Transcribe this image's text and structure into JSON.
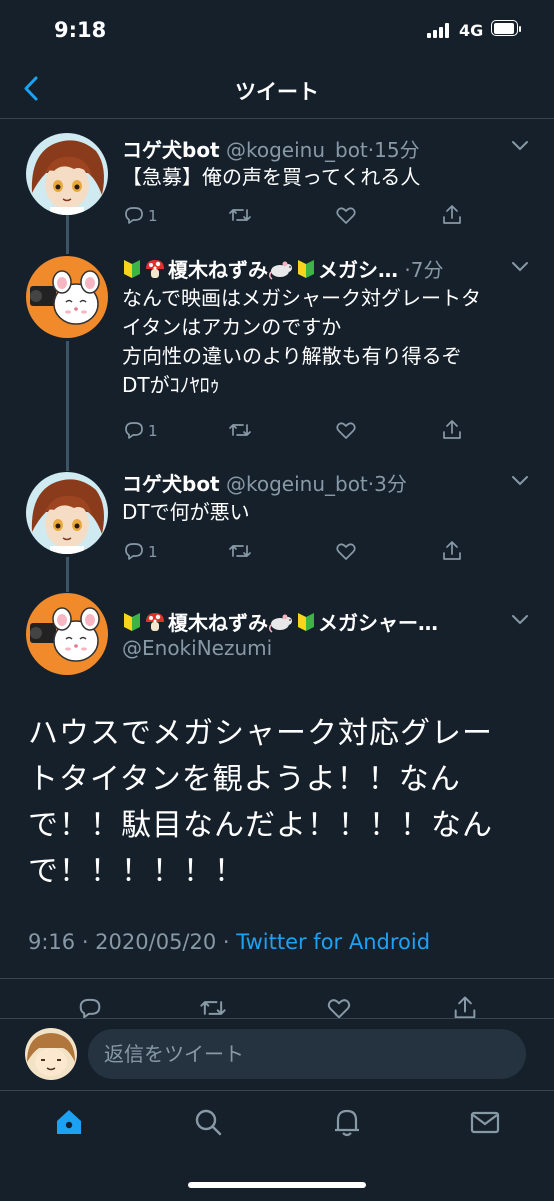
{
  "status_bar": {
    "time": "9:18",
    "network": "4G"
  },
  "header": {
    "title": "ツイート"
  },
  "colors": {
    "background": "#15202b",
    "accent": "#1da1f2",
    "muted": "#8899a6",
    "divider": "#38444d"
  },
  "thread": [
    {
      "name": "コゲ犬bot",
      "handle": "@kogeinu_bot",
      "time": "15分",
      "text_lines": [
        "【急募】俺の声を買ってくれる人"
      ],
      "reply_count": "1"
    },
    {
      "name": "榎木ねずみ",
      "name_tail": "メガシ…",
      "time": "7分",
      "text_lines": [
        "なんで映画はメガシャーク対グレートタ",
        "イタンはアカンのですか",
        "方向性の違いのより解散も有り得るぞ",
        "DTがｺﾉﾔﾛｩ"
      ],
      "reply_count": "1"
    },
    {
      "name": "コゲ犬bot",
      "handle": "@kogeinu_bot",
      "time": "3分",
      "text_lines": [
        "DTで何が悪い"
      ],
      "reply_count": "1"
    }
  ],
  "main_tweet": {
    "name": "榎木ねずみ",
    "name_tail": "メガシャー…",
    "handle": "@EnokiNezumi",
    "text_lines": [
      "ハウスでメガシャーク対応グレー",
      "トタイタンを観ようよ！！なん",
      "で！！駄目なんだよ！！！！なん",
      "で！！！！！！"
    ],
    "timestamp": "9:16 · 2020/05/20 · ",
    "source": "Twitter for Android"
  },
  "reply_bar": {
    "placeholder": "返信をツイート"
  },
  "tabs": [
    "home-icon",
    "search-icon",
    "notifications-icon",
    "messages-icon"
  ]
}
